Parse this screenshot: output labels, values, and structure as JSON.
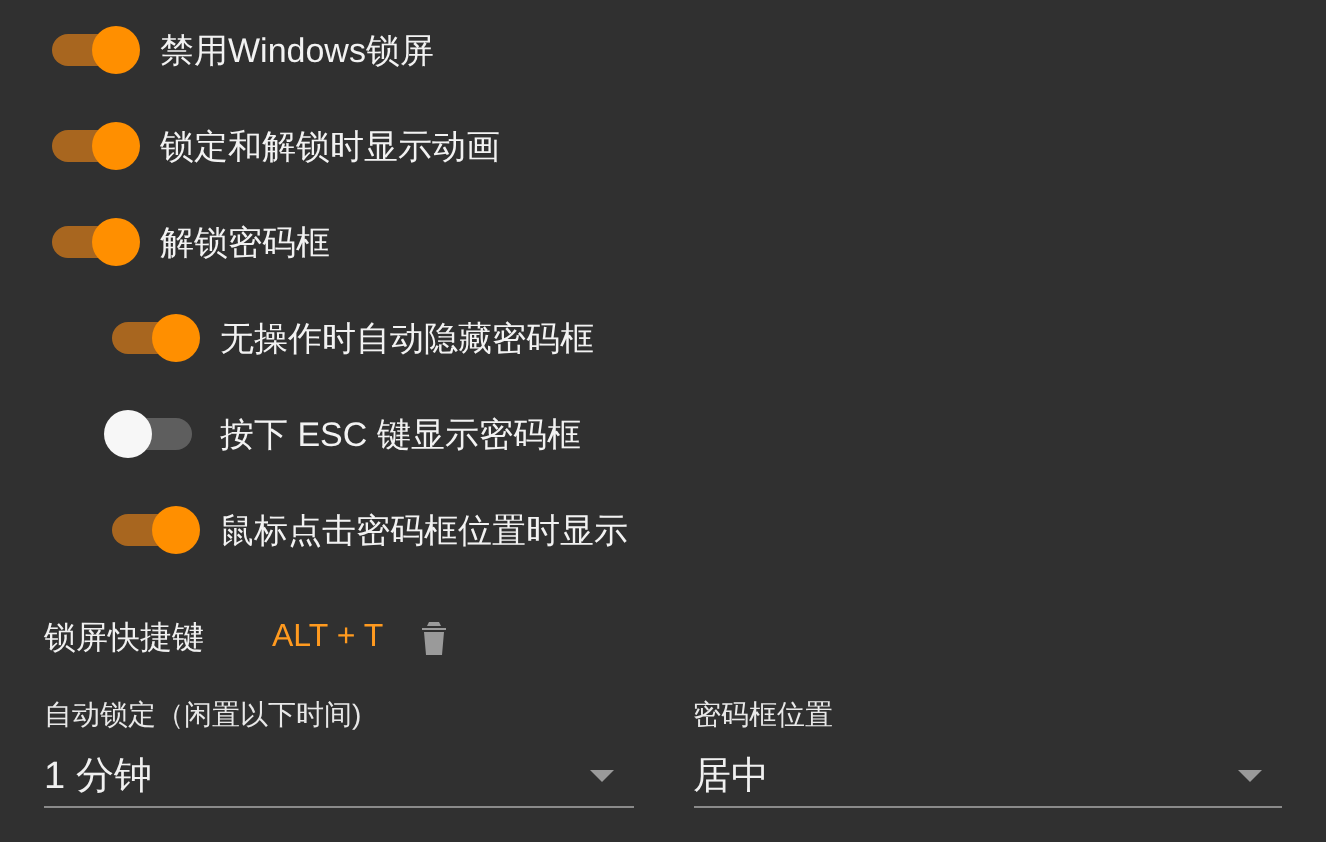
{
  "toggles": [
    {
      "label": "禁用Windows锁屏",
      "on": true
    },
    {
      "label": "锁定和解锁时显示动画",
      "on": true
    },
    {
      "label": "解锁密码框",
      "on": true,
      "children": [
        {
          "label": "无操作时自动隐藏密码框",
          "on": true
        },
        {
          "label": "按下 ESC 键显示密码框",
          "on": false
        },
        {
          "label": "鼠标点击密码框位置时显示",
          "on": true
        }
      ]
    }
  ],
  "shortcut": {
    "label": "锁屏快捷键",
    "value": "ALT + T"
  },
  "selects": [
    {
      "label": "自动锁定（闲置以下时间)",
      "value": "1 分钟"
    },
    {
      "label": "密码框位置",
      "value": "居中"
    }
  ]
}
